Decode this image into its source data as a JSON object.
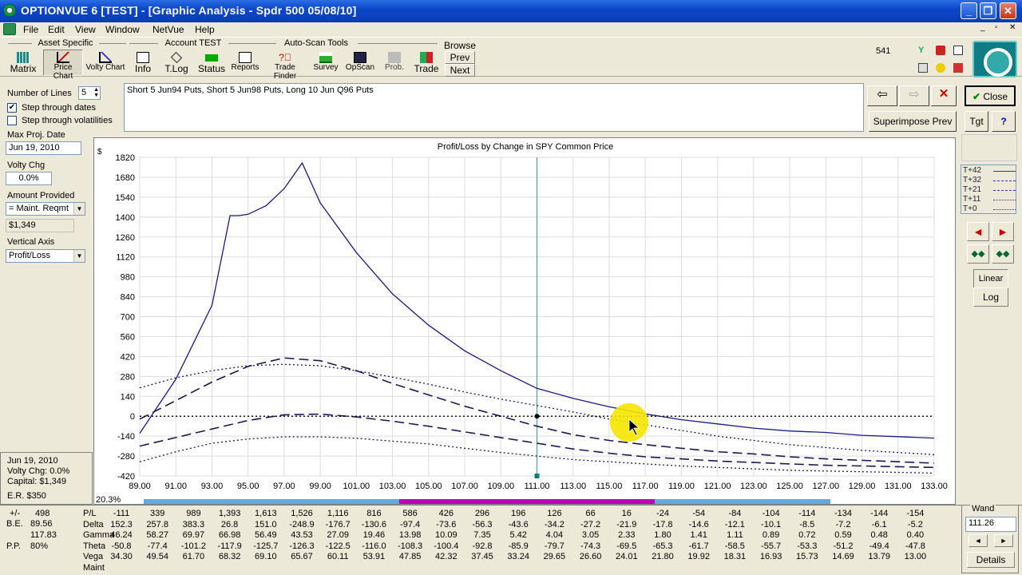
{
  "window": {
    "title": "OPTIONVUE 6   [TEST] - [Graphic Analysis - Spdr 500  05/08/10]"
  },
  "menu": [
    "File",
    "Edit",
    "View",
    "Window",
    "NetVue",
    "Help"
  ],
  "toolbar": {
    "groups": [
      "Asset Specific",
      "Account TEST",
      "Auto-Scan Tools"
    ],
    "buttons": [
      "Matrix",
      "Price Chart",
      "Volty Chart",
      "Info",
      "T.Log",
      "Status",
      "Reports",
      "Trade Finder",
      "Survey",
      "OpScan",
      "Prob.",
      "Trade"
    ],
    "browse": {
      "label": "Browse",
      "prev": "Prev",
      "next": "Next"
    },
    "count": "541"
  },
  "left": {
    "num_lines_label": "Number of Lines",
    "num_lines": "5",
    "step_dates": "Step through dates",
    "step_vol": "Step through volatilities",
    "max_proj_label": "Max Proj. Date",
    "max_proj": "Jun 19, 2010",
    "volty_label": "Volty Chg",
    "volty": "0.0%",
    "amount_label": "Amount Provided",
    "amount_sel": "= Maint. Reqmt",
    "amount": "$1,349",
    "vaxis_label": "Vertical Axis",
    "vaxis": "Profit/Loss"
  },
  "position_desc": "Short 5 Jun94 Puts, Short 5 Jun98 Puts, Long 10 Jun Q96 Puts",
  "right": {
    "close": "Close",
    "superimpose": "Superimpose Prev",
    "tgt": "Tgt",
    "help": "?",
    "linear": "Linear",
    "log": "Log"
  },
  "legend": [
    "T+42",
    "T+32",
    "T+21",
    "T+11",
    "T+0"
  ],
  "chart_data": {
    "type": "line",
    "title": "Profit/Loss by Change in SPY Common Price",
    "ylabel": "$",
    "xlim": [
      89,
      133
    ],
    "ylim": [
      -420,
      1820
    ],
    "x_ticks": [
      "89.00",
      "91.00",
      "93.00",
      "95.00",
      "97.00",
      "99.00",
      "101.00",
      "103.00",
      "105.00",
      "107.00",
      "109.00",
      "111.00",
      "113.00",
      "115.00",
      "117.00",
      "119.00",
      "121.00",
      "123.00",
      "125.00",
      "127.00",
      "129.00",
      "131.00",
      "133.00"
    ],
    "y_ticks": [
      "1820",
      "1680",
      "1540",
      "1400",
      "1260",
      "1120",
      "980",
      "840",
      "700",
      "560",
      "420",
      "280",
      "140",
      "0",
      "-140",
      "-280",
      "-420"
    ],
    "current_price": 111.0,
    "scale_pct": "20.3%",
    "series": [
      {
        "name": "T+42",
        "style": "solid",
        "x": [
          89,
          91,
          93,
          94,
          94.5,
          95,
          96,
          97,
          98,
          99,
          101,
          103,
          105,
          107,
          109,
          111,
          113,
          115,
          117,
          119,
          121,
          123,
          125,
          127,
          129,
          131,
          133
        ],
        "y": [
          -120,
          260,
          780,
          1410,
          1410,
          1420,
          1480,
          1600,
          1780,
          1500,
          1150,
          860,
          640,
          460,
          320,
          196,
          126,
          66,
          16,
          -24,
          -54,
          -84,
          -104,
          -114,
          -134,
          -144,
          -154
        ]
      },
      {
        "name": "T+32",
        "style": "dash",
        "x": [
          89,
          91,
          93,
          95,
          97,
          99,
          101,
          103,
          105,
          107,
          109,
          111,
          113,
          115,
          117,
          119,
          121,
          123,
          125,
          127,
          129,
          131,
          133
        ],
        "y": [
          -20,
          110,
          240,
          350,
          410,
          390,
          320,
          230,
          150,
          70,
          0,
          -70,
          -130,
          -170,
          -200,
          -225,
          -250,
          -265,
          -285,
          -300,
          -310,
          -320,
          -330
        ]
      },
      {
        "name": "T+21",
        "style": "dot",
        "x": [
          89,
          91,
          93,
          95,
          97,
          99,
          101,
          103,
          105,
          107,
          109,
          111,
          113,
          115,
          117,
          119,
          121,
          123,
          125,
          127,
          129,
          131,
          133
        ],
        "y": [
          200,
          270,
          320,
          355,
          365,
          355,
          320,
          275,
          225,
          170,
          120,
          75,
          30,
          -20,
          -60,
          -100,
          -140,
          -170,
          -200,
          -220,
          -240,
          -255,
          -270
        ]
      },
      {
        "name": "T+11",
        "style": "dash",
        "x": [
          89,
          91,
          93,
          95,
          97,
          99,
          101,
          103,
          105,
          107,
          109,
          111,
          113,
          115,
          117,
          119,
          121,
          123,
          125,
          127,
          129,
          131,
          133
        ],
        "y": [
          -210,
          -150,
          -90,
          -30,
          10,
          15,
          -5,
          -35,
          -70,
          -110,
          -150,
          -190,
          -230,
          -260,
          -285,
          -300,
          -315,
          -325,
          -335,
          -345,
          -350,
          -355,
          -360
        ]
      },
      {
        "name": "T+0",
        "style": "dot",
        "x": [
          89,
          91,
          93,
          95,
          97,
          99,
          101,
          103,
          105,
          107,
          109,
          111,
          113,
          115,
          117,
          119,
          121,
          123,
          125,
          127,
          129,
          131,
          133
        ],
        "y": [
          -320,
          -250,
          -190,
          -160,
          -145,
          -145,
          -155,
          -175,
          -195,
          -225,
          -255,
          -280,
          -305,
          -320,
          -335,
          -350,
          -360,
          -370,
          -380,
          -385,
          -390,
          -395,
          -400
        ]
      },
      {
        "name": "zero",
        "style": "dotted-black",
        "x": [
          89,
          133
        ],
        "y": [
          0,
          0
        ]
      }
    ]
  },
  "stats": {
    "date": "Jun 19, 2010",
    "volty": "Volty Chg:  0.0%",
    "capital": "Capital:  $1,349",
    "er": "E.R.  $350"
  },
  "bottom_left": {
    "pm": "+/-",
    "pm_val": "498",
    "be": "B.E.",
    "be1": "89.56",
    "be2": "117.83",
    "pp": "P.P.",
    "pp_val": "80%"
  },
  "table": {
    "rows": [
      "P/L",
      "Delta",
      "Gamma",
      "Theta",
      "Vega",
      "Maint"
    ],
    "columns": [
      [
        "-111",
        "152.3",
        "46.24",
        "-50.8",
        "34.30"
      ],
      [
        "339",
        "257.8",
        "58.27",
        "-77.4",
        "49.54"
      ],
      [
        "989",
        "383.3",
        "69.97",
        "-101.2",
        "61.70"
      ],
      [
        "1,393",
        "26.8",
        "66.98",
        "-117.9",
        "68.32"
      ],
      [
        "1,613",
        "151.0",
        "56.49",
        "-125.7",
        "69.10"
      ],
      [
        "1,526",
        "-248.9",
        "43.53",
        "-126.3",
        "65.67"
      ],
      [
        "1,116",
        "-176.7",
        "27.09",
        "-122.5",
        "60.11"
      ],
      [
        "816",
        "-130.6",
        "19.46",
        "-116.0",
        "53.91"
      ],
      [
        "586",
        "-97.4",
        "13.98",
        "-108.3",
        "47.85"
      ],
      [
        "426",
        "-73.6",
        "10.09",
        "-100.4",
        "42.32"
      ],
      [
        "296",
        "-56.3",
        "7.35",
        "-92.8",
        "37.45"
      ],
      [
        "196",
        "-43.6",
        "5.42",
        "-85.9",
        "33.24"
      ],
      [
        "126",
        "-34.2",
        "4.04",
        "-79.7",
        "29.65"
      ],
      [
        "66",
        "-27.2",
        "3.05",
        "-74.3",
        "26.60"
      ],
      [
        "16",
        "-21.9",
        "2.33",
        "-69.5",
        "24.01"
      ],
      [
        "-24",
        "-17.8",
        "1.80",
        "-65.3",
        "21.80"
      ],
      [
        "-54",
        "-14.6",
        "1.41",
        "-61.7",
        "19.92"
      ],
      [
        "-84",
        "-12.1",
        "1.11",
        "-58.5",
        "18.31"
      ],
      [
        "-104",
        "-10.1",
        "0.89",
        "-55.7",
        "16.93"
      ],
      [
        "-114",
        "-8.5",
        "0.72",
        "-53.3",
        "15.73"
      ],
      [
        "-134",
        "-7.2",
        "0.59",
        "-51.2",
        "14.69"
      ],
      [
        "-144",
        "-6.1",
        "0.48",
        "-49.4",
        "13.79"
      ],
      [
        "-154",
        "-5.2",
        "0.40",
        "-47.8",
        "13.00"
      ]
    ]
  },
  "wand": {
    "label": "Wand",
    "value": "111.26",
    "details": "Details"
  }
}
